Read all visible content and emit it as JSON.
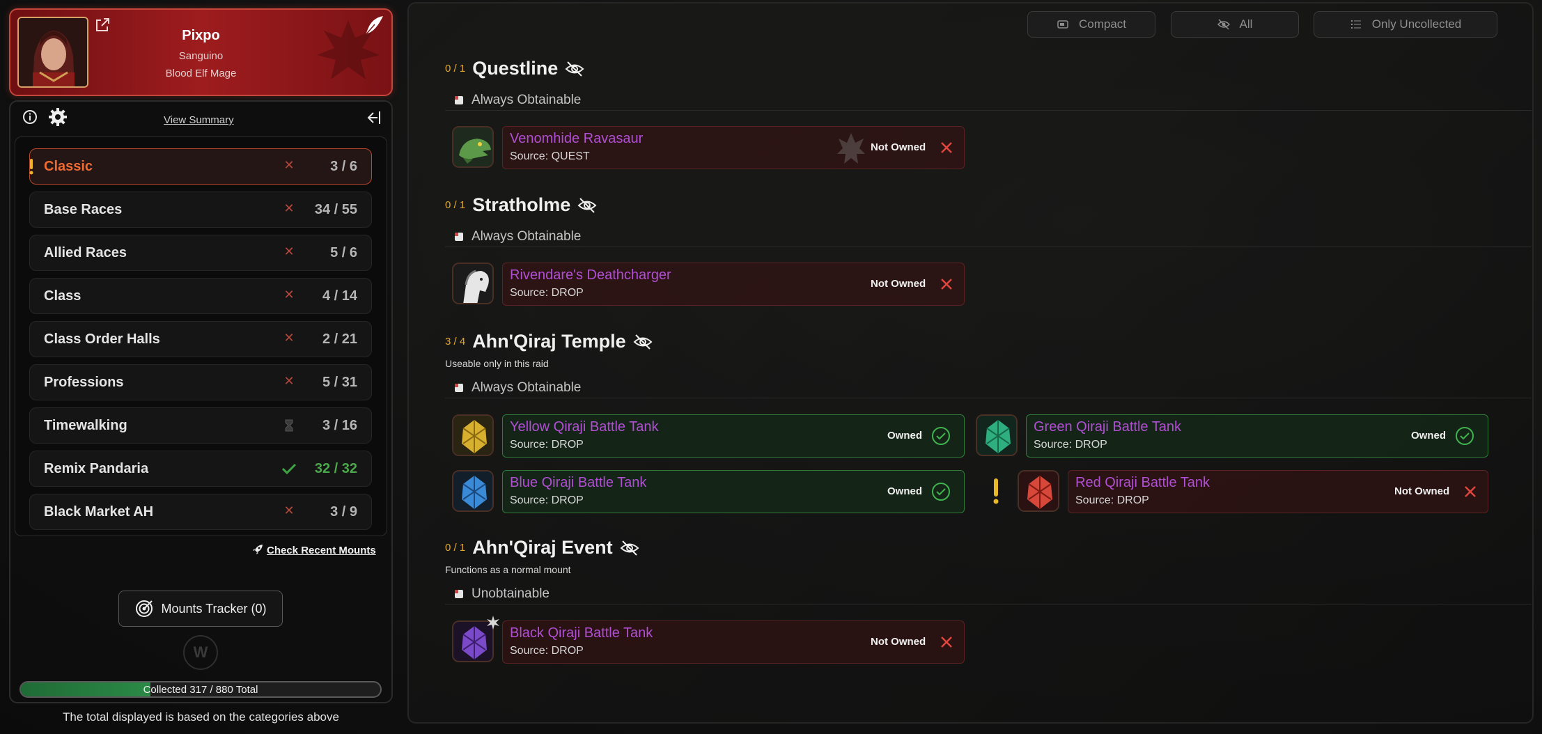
{
  "character": {
    "name": "Pixpo",
    "realm": "Sanguino",
    "race_class": "Blood Elf Mage"
  },
  "toolbar": {
    "view_summary": "View Summary"
  },
  "categories": [
    {
      "label": "Classic",
      "count": "3 / 6",
      "status": "incomplete",
      "active": true,
      "alert": true
    },
    {
      "label": "Base Races",
      "count": "34 / 55",
      "status": "incomplete"
    },
    {
      "label": "Allied Races",
      "count": "5 / 6",
      "status": "incomplete"
    },
    {
      "label": "Class",
      "count": "4 / 14",
      "status": "incomplete"
    },
    {
      "label": "Class Order Halls",
      "count": "2 / 21",
      "status": "incomplete"
    },
    {
      "label": "Professions",
      "count": "5 / 31",
      "status": "incomplete"
    },
    {
      "label": "Timewalking",
      "count": "3 / 16",
      "status": "timewalking"
    },
    {
      "label": "Remix Pandaria",
      "count": "32 / 32",
      "status": "complete"
    },
    {
      "label": "Black Market AH",
      "count": "3 / 9",
      "status": "incomplete"
    }
  ],
  "recent": {
    "label": "Check Recent Mounts"
  },
  "tracker": {
    "label": "Mounts Tracker (0)"
  },
  "logo_letter": "W",
  "progress": {
    "label": "Collected 317 / 880 Total",
    "fraction": 0.36
  },
  "total_note": "The total displayed is based on the categories above",
  "filters": {
    "compact": "Compact",
    "all": "All",
    "only_uncollected": "Only Uncollected"
  },
  "sections": [
    {
      "count": "0 / 1",
      "title": "Questline",
      "note": "",
      "sub": "Always Obtainable",
      "mounts": [
        {
          "name": "Venomhide Ravasaur",
          "source": "Source: QUEST",
          "status": "Not Owned",
          "faction": "horde"
        }
      ]
    },
    {
      "count": "0 / 1",
      "title": "Stratholme",
      "note": "",
      "sub": "Always Obtainable",
      "mounts": [
        {
          "name": "Rivendare's Deathcharger",
          "source": "Source: DROP",
          "status": "Not Owned"
        }
      ]
    },
    {
      "count": "3 / 4",
      "title": "Ahn'Qiraj Temple",
      "note": "Useable only in this raid",
      "sub": "Always Obtainable",
      "mounts": [
        {
          "name": "Yellow Qiraji Battle Tank",
          "source": "Source: DROP",
          "status": "Owned"
        },
        {
          "name": "Green Qiraji Battle Tank",
          "source": "Source: DROP",
          "status": "Owned"
        },
        {
          "name": "Blue Qiraji Battle Tank",
          "source": "Source: DROP",
          "status": "Owned"
        },
        {
          "name": "Red Qiraji Battle Tank",
          "source": "Source: DROP",
          "status": "Not Owned"
        }
      ]
    },
    {
      "count": "0 / 1",
      "title": "Ahn'Qiraj Event",
      "note": "Functions as a normal mount",
      "sub": "Unobtainable",
      "mounts": [
        {
          "name": "Black Qiraji Battle Tank",
          "source": "Source: DROP",
          "status": "Not Owned"
        }
      ]
    }
  ],
  "colors": {
    "owned": "#2f7c3a",
    "not_owned": "#5a2222",
    "mount_name": "#b14fd4",
    "accent_orange": "#ee6b33",
    "count_gold": "#e0a830"
  }
}
